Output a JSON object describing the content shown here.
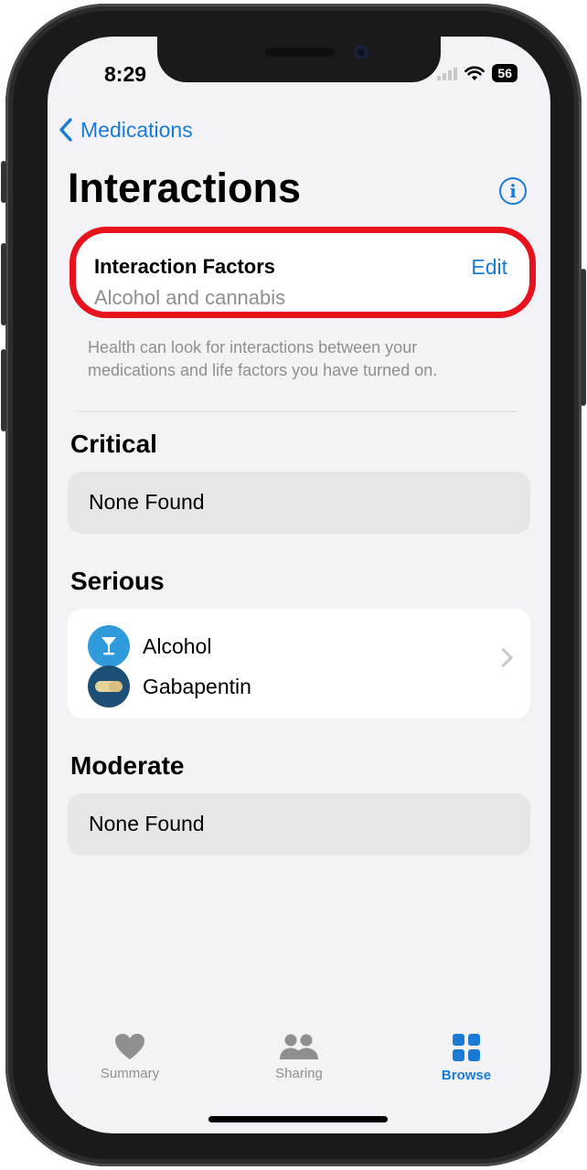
{
  "status_bar": {
    "time": "8:29",
    "battery": "56"
  },
  "nav": {
    "back_label": "Medications"
  },
  "page": {
    "title": "Interactions"
  },
  "interaction_factors": {
    "title": "Interaction Factors",
    "value": "Alcohol and cannabis",
    "edit_label": "Edit",
    "footnote": "Health can look for interactions between your medications and life factors you have turned on."
  },
  "sections": {
    "critical": {
      "heading": "Critical",
      "empty_label": "None Found"
    },
    "serious": {
      "heading": "Serious",
      "items": [
        "Alcohol",
        "Gabapentin"
      ]
    },
    "moderate": {
      "heading": "Moderate",
      "empty_label": "None Found"
    }
  },
  "tab_bar": {
    "tabs": [
      {
        "label": "Summary",
        "icon": "heart-icon",
        "active": false
      },
      {
        "label": "Sharing",
        "icon": "people-icon",
        "active": false
      },
      {
        "label": "Browse",
        "icon": "grid-icon",
        "active": true
      }
    ]
  },
  "colors": {
    "accent": "#1a7bd5",
    "highlight": "#e8121c",
    "background": "#f2f2f7"
  }
}
